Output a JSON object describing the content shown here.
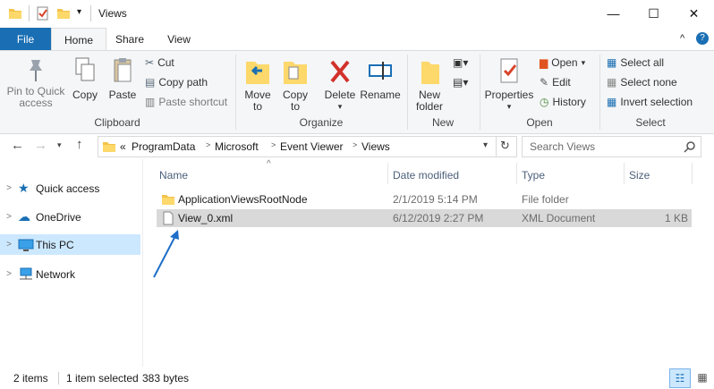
{
  "window": {
    "title": "Views"
  },
  "ribbon_tabs": [
    "File",
    "Home",
    "Share",
    "View"
  ],
  "ribbon": {
    "clipboard": {
      "pin_label": "Pin to Quick\naccess",
      "copy_label": "Copy",
      "paste_label": "Paste",
      "cut_label": "Cut",
      "copy_path_label": "Copy path",
      "paste_shortcut_label": "Paste shortcut",
      "group_label": "Clipboard"
    },
    "organize": {
      "move_label": "Move\nto",
      "copyto_label": "Copy\nto",
      "delete_label": "Delete",
      "rename_label": "Rename",
      "group_label": "Organize"
    },
    "new": {
      "folder_label": "New\nfolder",
      "group_label": "New"
    },
    "open": {
      "properties_label": "Properties",
      "open_label": "Open",
      "edit_label": "Edit",
      "history_label": "History",
      "group_label": "Open"
    },
    "select": {
      "select_all_label": "Select all",
      "select_none_label": "Select none",
      "invert_label": "Invert selection",
      "group_label": "Select"
    }
  },
  "address": {
    "overflow": "«",
    "crumbs": [
      "ProgramData",
      "Microsoft",
      "Event Viewer",
      "Views"
    ],
    "search_placeholder": "Search Views"
  },
  "nav": [
    {
      "label": "Quick access",
      "icon": "star-icon"
    },
    {
      "label": "OneDrive",
      "icon": "cloud-icon"
    },
    {
      "label": "This PC",
      "icon": "monitor-icon",
      "selected": true
    },
    {
      "label": "Network",
      "icon": "network-icon"
    }
  ],
  "columns": {
    "name": "Name",
    "date": "Date modified",
    "type": "Type",
    "size": "Size"
  },
  "files": [
    {
      "name": "ApplicationViewsRootNode",
      "date": "2/1/2019 5:14 PM",
      "type": "File folder",
      "size": ""
    },
    {
      "name": "View_0.xml",
      "date": "6/12/2019 2:27 PM",
      "type": "XML Document",
      "size": "1 KB"
    }
  ],
  "status": {
    "items": "2 items",
    "selected": "1 item selected",
    "bytes": "383 bytes"
  },
  "colors": {
    "accent": "#1a6fb4",
    "selection": "#cce8ff",
    "row_selected": "#d9d9d9",
    "arrow": "#1f6fc9"
  }
}
